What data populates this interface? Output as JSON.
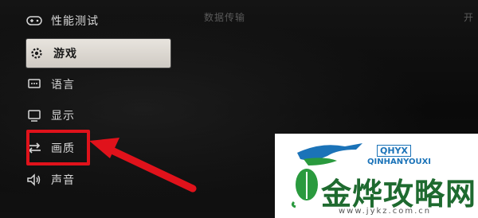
{
  "menu": {
    "items": [
      {
        "label": "性能测试",
        "icon": "gamepad-icon"
      },
      {
        "label": "游戏",
        "icon": "gear-icon",
        "selected": true
      },
      {
        "label": "语言",
        "icon": "chat-icon"
      },
      {
        "label": "显示",
        "icon": "monitor-icon"
      },
      {
        "label": "画质",
        "icon": "sliders-icon"
      },
      {
        "label": "声音",
        "icon": "speaker-icon"
      }
    ]
  },
  "header": {
    "tab_center": "数据传输",
    "tab_right": "开"
  },
  "annotation": {
    "color": "#e0121b"
  },
  "watermark": {
    "brand_box": "QHYX",
    "brand_sub": "QINHANYOUXI",
    "title": "金烨攻略网",
    "url": "www.jykz.com.cn"
  }
}
